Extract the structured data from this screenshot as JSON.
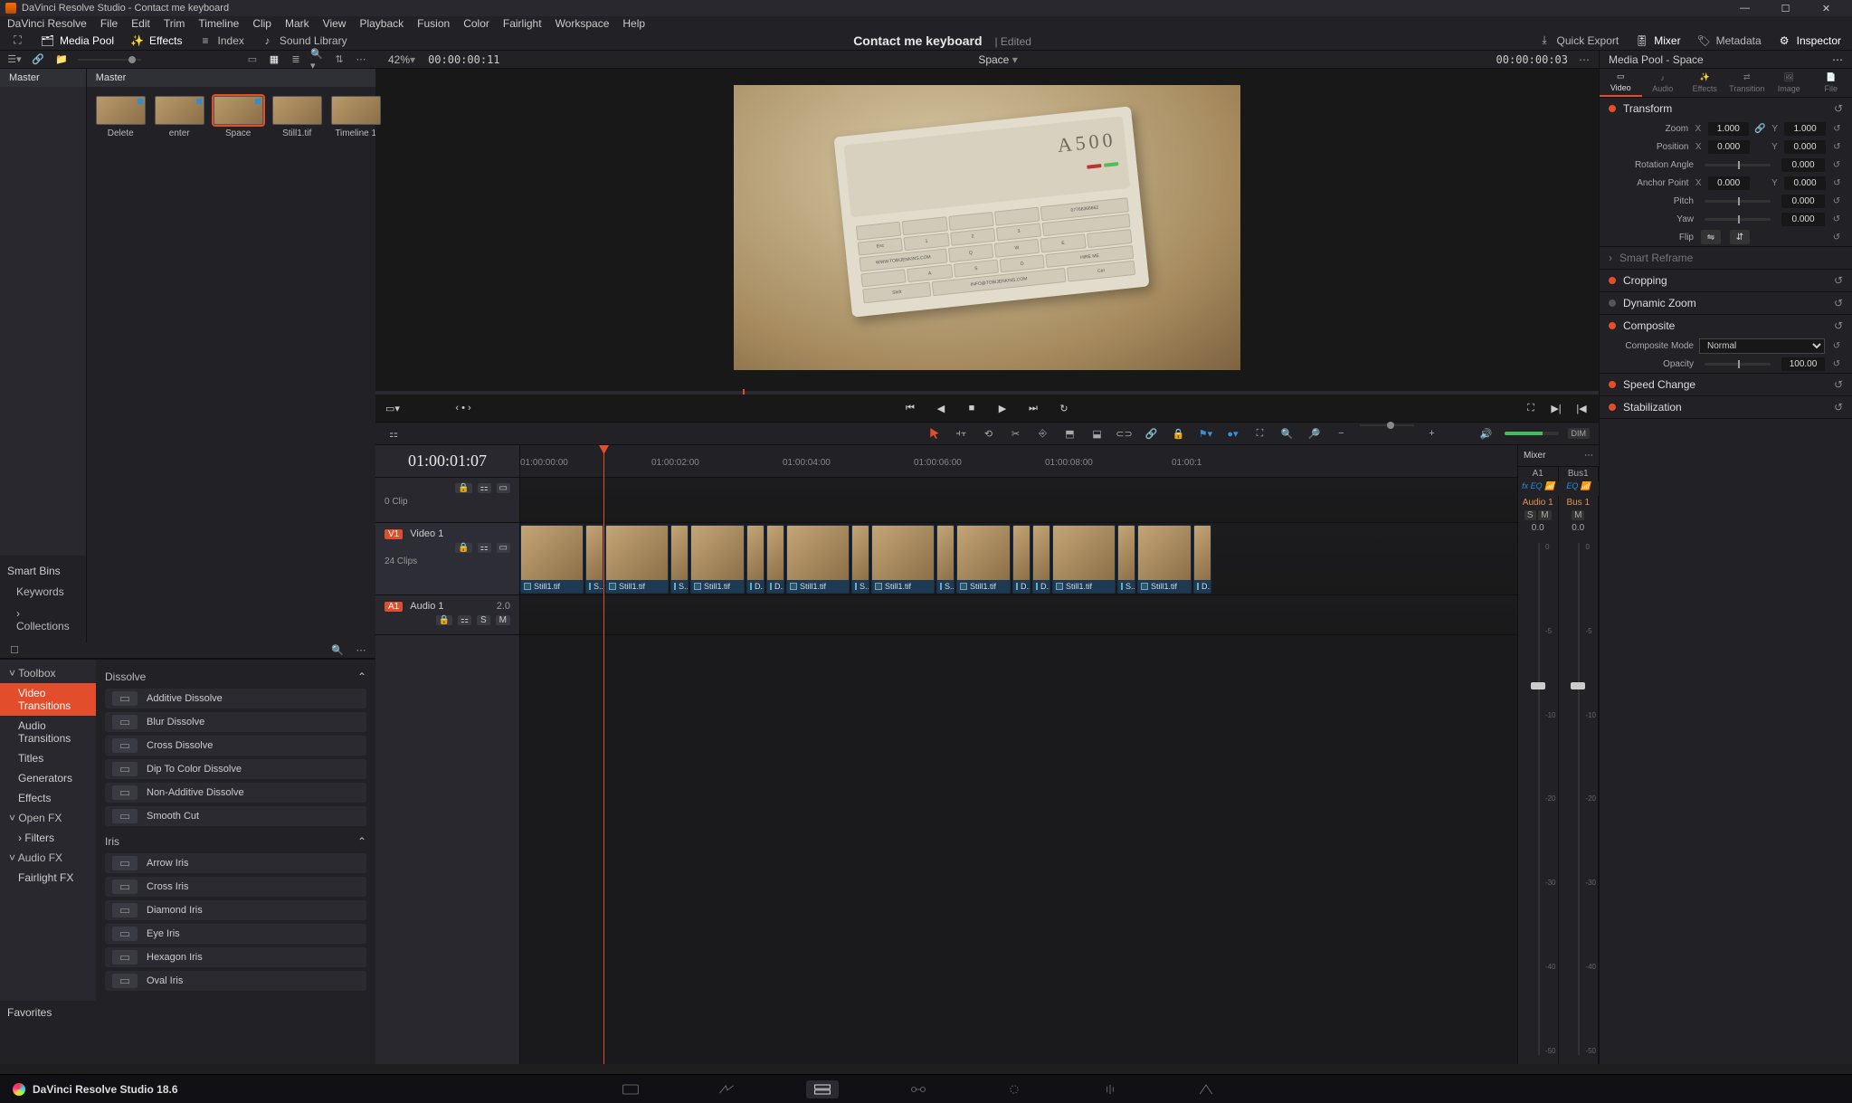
{
  "window": {
    "title": "DaVinci Resolve Studio - Contact me keyboard"
  },
  "menu": [
    "DaVinci Resolve",
    "File",
    "Edit",
    "Trim",
    "Timeline",
    "Clip",
    "Mark",
    "View",
    "Playback",
    "Fusion",
    "Color",
    "Fairlight",
    "Workspace",
    "Help"
  ],
  "topbar": {
    "media_pool": "Media Pool",
    "effects": "Effects",
    "index": "Index",
    "sound_library": "Sound Library",
    "project": "Contact me keyboard",
    "edited": "Edited",
    "quick_export": "Quick Export",
    "mixer": "Mixer",
    "metadata": "Metadata",
    "inspector": "Inspector"
  },
  "viewer": {
    "zoom": "42%",
    "src_tc": "00:00:00:11",
    "clip_name": "Space",
    "rec_tc": "00:00:00:03"
  },
  "bins": {
    "root": "Master",
    "current": "Master",
    "smart_bins": "Smart Bins",
    "keywords": "Keywords",
    "collections": "Collections",
    "favorites": "Favorites",
    "clips": [
      {
        "label": "Delete"
      },
      {
        "label": "enter"
      },
      {
        "label": "Space",
        "selected": true
      },
      {
        "label": "Still1.tif"
      },
      {
        "label": "Timeline 1"
      }
    ]
  },
  "fx": {
    "tree": {
      "toolbox": "Toolbox",
      "items": [
        "Video Transitions",
        "Audio Transitions",
        "Titles",
        "Generators",
        "Effects"
      ],
      "openfx": "Open FX",
      "filters": "Filters",
      "audiofx": "Audio FX",
      "fairlightfx": "Fairlight FX"
    },
    "sections": [
      {
        "title": "Dissolve",
        "items": [
          "Additive Dissolve",
          "Blur Dissolve",
          "Cross Dissolve",
          "Dip To Color Dissolve",
          "Non-Additive Dissolve",
          "Smooth Cut"
        ]
      },
      {
        "title": "Iris",
        "items": [
          "Arrow Iris",
          "Cross Iris",
          "Diamond Iris",
          "Eye Iris",
          "Hexagon Iris",
          "Oval Iris"
        ]
      }
    ]
  },
  "timeline": {
    "tc": "01:00:01:07",
    "ruler": [
      "01:00:00:00",
      "01:00:02:00",
      "01:00:04:00",
      "01:00:06:00",
      "01:00:08:00",
      "01:00:1"
    ],
    "v0": {
      "clips_label": "0 Clip"
    },
    "v1": {
      "id": "V1",
      "name": "Video 1",
      "clips_label": "24 Clips",
      "clip_labels": [
        "Still1.tif",
        "S...",
        "Still1.tif",
        "S...",
        "Still1.tif",
        "D...",
        "D...",
        "Still1.tif",
        "S...",
        "Still1.tif",
        "S...",
        "Still1.tif",
        "D...",
        "D...",
        "Still1.tif",
        "S...",
        "Still1.tif",
        "D..."
      ]
    },
    "a1": {
      "id": "A1",
      "name": "Audio 1",
      "ch": "2.0",
      "s": "S",
      "m": "M"
    }
  },
  "mixer": {
    "title": "Mixer",
    "channels": [
      "A1",
      "Bus1"
    ],
    "fx": "fx",
    "eq": "EQ",
    "labels": [
      "Audio 1",
      "Bus 1"
    ],
    "sm": {
      "s": "S",
      "m": "M"
    },
    "zero": "0.0",
    "scale": [
      "0",
      "-5",
      "-10",
      "-20",
      "-30",
      "-40",
      "-50"
    ]
  },
  "inspector": {
    "header": "Media Pool - Space",
    "tabs": [
      "Video",
      "Audio",
      "Effects",
      "Transition",
      "Image",
      "File"
    ],
    "transform": {
      "title": "Transform",
      "zoom": "Zoom",
      "zoom_x": "1.000",
      "zoom_y": "1.000",
      "position": "Position",
      "pos_x": "0.000",
      "pos_y": "0.000",
      "rotation": "Rotation Angle",
      "rot_v": "0.000",
      "anchor": "Anchor Point",
      "anc_x": "0.000",
      "anc_y": "0.000",
      "pitch": "Pitch",
      "pitch_v": "0.000",
      "yaw": "Yaw",
      "yaw_v": "0.000",
      "flip": "Flip"
    },
    "smart_reframe": "Smart Reframe",
    "cropping": "Cropping",
    "dynamic_zoom": "Dynamic Zoom",
    "composite": {
      "title": "Composite",
      "mode_lbl": "Composite Mode",
      "mode": "Normal",
      "opacity_lbl": "Opacity",
      "opacity": "100.00"
    },
    "speed": "Speed Change",
    "stabilization": "Stabilization"
  },
  "pagebar": {
    "brand": "DaVinci Resolve Studio 18.6"
  }
}
